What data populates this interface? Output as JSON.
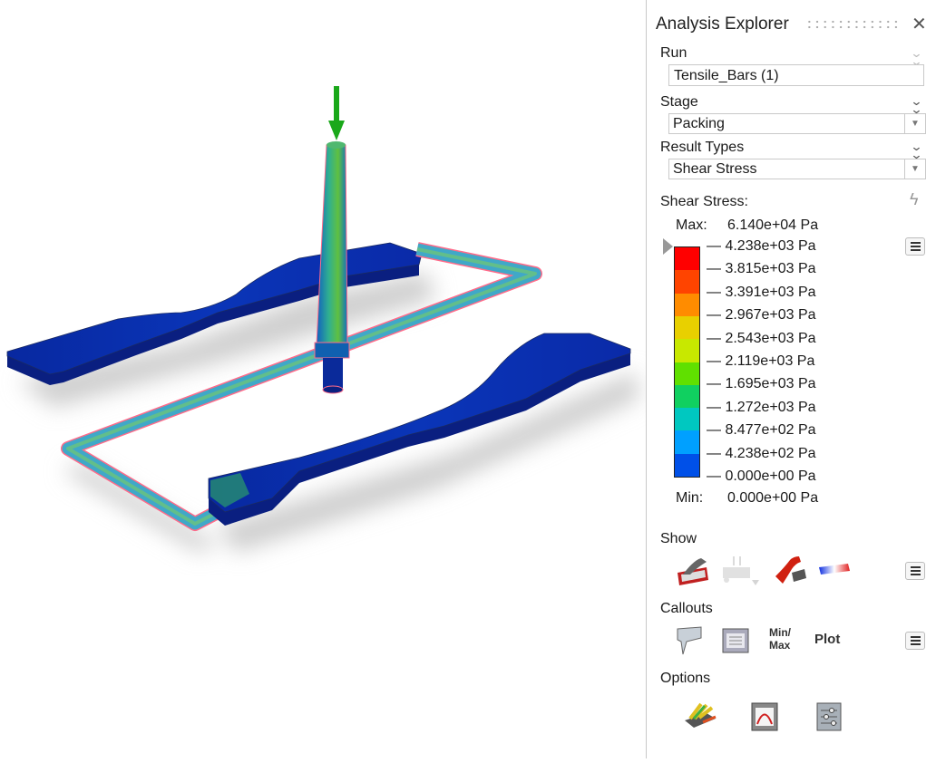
{
  "panel": {
    "title": "Analysis Explorer",
    "run": {
      "label": "Run",
      "value": "Tensile_Bars (1)"
    },
    "stage": {
      "label": "Stage",
      "value": "Packing"
    },
    "result_types": {
      "label": "Result Types",
      "value": "Shear Stress"
    },
    "legend": {
      "title": "Shear Stress:",
      "max_label": "Max:",
      "max_value": "6.140e+04 Pa",
      "min_label": "Min:",
      "min_value": "0.000e+00 Pa",
      "ticks": [
        "— 4.238e+03 Pa",
        "— 3.815e+03 Pa",
        "— 3.391e+03 Pa",
        "— 2.967e+03 Pa",
        "— 2.543e+03 Pa",
        "— 2.119e+03 Pa",
        "— 1.695e+03 Pa",
        "— 1.272e+03 Pa",
        "— 8.477e+02 Pa",
        "— 4.238e+02 Pa",
        "— 0.000e+00 Pa"
      ],
      "band_colors": [
        "#ff0000",
        "#ff4400",
        "#ff8c00",
        "#e8d000",
        "#c8e800",
        "#60e000",
        "#10d060",
        "#00c8c0",
        "#00a0ff",
        "#0050e8",
        "#0010c0"
      ]
    },
    "show": {
      "label": "Show",
      "icons": [
        "part-outline-icon",
        "mesh-features-icon",
        "shaded-part-icon",
        "color-bar-icon"
      ]
    },
    "callouts": {
      "label": "Callouts",
      "minmax": "Min/\nMax",
      "min_line": "Min/",
      "max_line": "Max",
      "plot": "Plot"
    },
    "options": {
      "label": "Options",
      "icons": [
        "color-options-icon",
        "plot-options-icon",
        "settings-options-icon"
      ]
    }
  },
  "colors": {
    "accent_green": "#1aa81a",
    "part_blue": "#0a2fb0",
    "runner_edge": "#ff6b8a"
  }
}
